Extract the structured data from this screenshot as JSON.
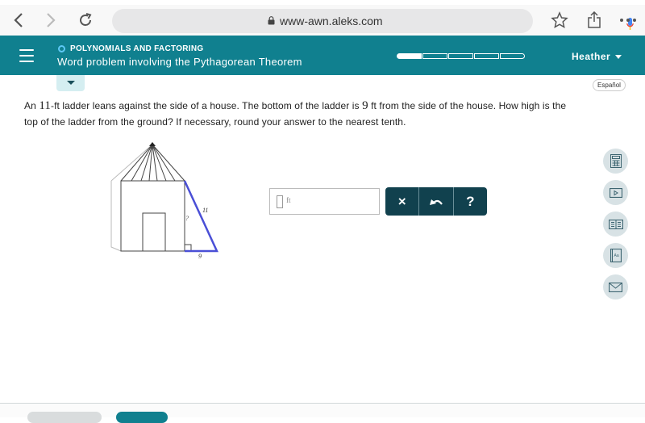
{
  "browser": {
    "url": "www-awn.aleks.com",
    "icons": [
      "back-icon",
      "forward-icon",
      "reload-icon",
      "lock-icon",
      "mic-icon",
      "bookmark-star-icon",
      "share-icon",
      "more-icon"
    ]
  },
  "header": {
    "topic": "POLYNOMIALS AND FACTORING",
    "title": "Word problem involving the Pythagorean Theorem",
    "user": "Heather",
    "progress": {
      "segments": 5,
      "completed_fraction": 0.2
    }
  },
  "language_button": "Español",
  "question": {
    "part1": "An ",
    "ladder_length": "11",
    "part2": "-ft ladder leans against the side of a house. The bottom of the ladder is ",
    "distance": "9",
    "part3": " ft from the side of the house. How high is the top of the ladder from the ground? If necessary, round your answer to the nearest tenth.",
    "unit_ft": "ft"
  },
  "figure": {
    "hypotenuse_label": "11",
    "base_label": "9",
    "height_label": "?"
  },
  "answer": {
    "value": "",
    "unit": "ft"
  },
  "buttons": {
    "clear": "×",
    "undo": "undo",
    "help": "?"
  },
  "tools": [
    "calculator-icon",
    "video-icon",
    "ebook-icon",
    "dictionary-icon",
    "message-icon"
  ],
  "colors": {
    "brand": "#10808f",
    "button_dark": "#11414e",
    "ladder": "#4a4fd6"
  }
}
